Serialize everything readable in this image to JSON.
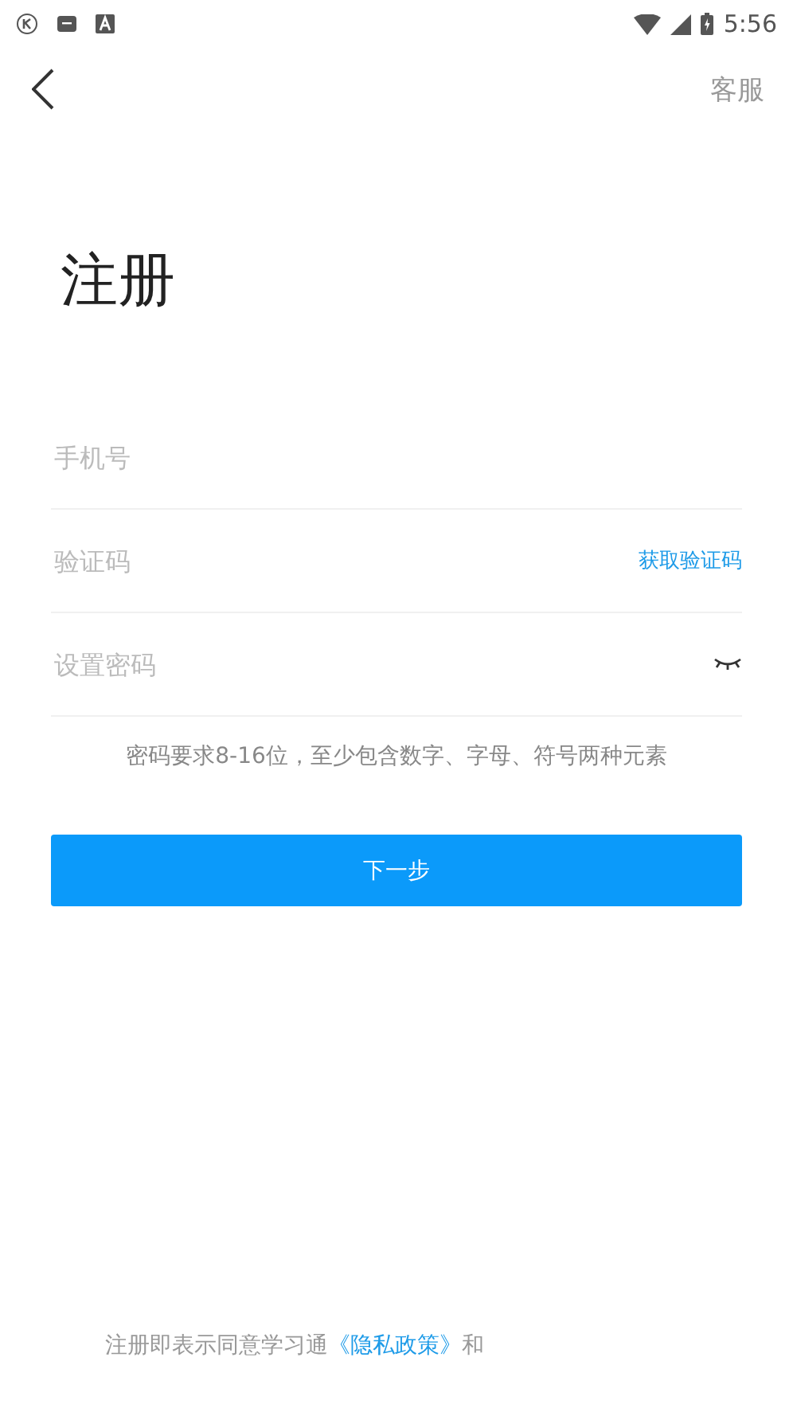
{
  "status_bar": {
    "time": "5:56"
  },
  "header": {
    "service_link": "客服"
  },
  "title": "注册",
  "fields": [
    {
      "kind": "text",
      "placeholder": "手机号"
    },
    {
      "kind": "code",
      "placeholder": "验证码",
      "action": "获取验证码"
    },
    {
      "kind": "password",
      "placeholder": "设置密码"
    }
  ],
  "password_hint": "密码要求8-16位，至少包含数字、字母、符号两种元素",
  "next_button": "下一步",
  "footer": {
    "text": "注册即表示同意学习通",
    "privacy_link": "《隐私政策》",
    "tail": "和"
  }
}
